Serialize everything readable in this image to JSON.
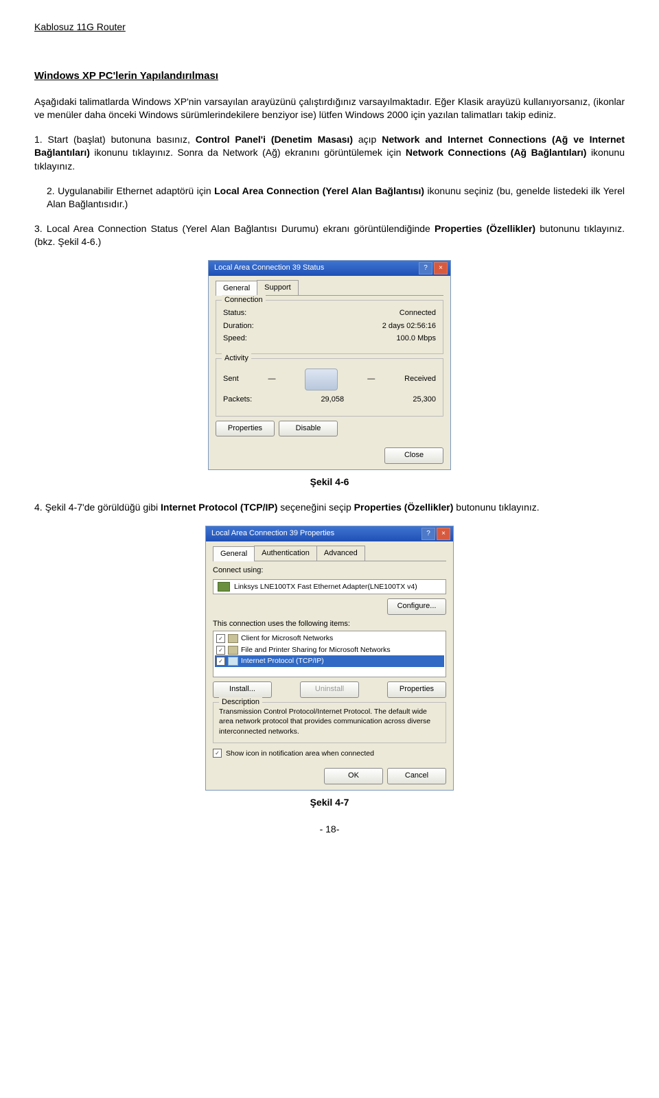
{
  "header": "Kablosuz 11G Router",
  "title": "Windows XP PC'lerin Yapılandırılması",
  "p_intro1": "Aşağıdaki talimatlarda Windows XP'nin varsayılan arayüzünü çalıştırdığınız varsayılmaktadır. Eğer Klasik arayüzü kullanıyorsanız, (ikonlar ve menüler daha önceki Windows sürümlerindekilere benziyor ise) lütfen Windows 2000 için yazılan talimatları takip ediniz.",
  "step1_a": "1. Start (başlat) butonuna basınız, ",
  "step1_b": "Control Panel'i (Denetim Masası)",
  "step1_c": " açıp ",
  "step1_d": "Network and Internet Connections (Ağ ve Internet Bağlantıları)",
  "step1_e": " ikonunu tıklayınız. Sonra da Network (Ağ) ekranını görüntülemek için ",
  "step1_f": "Network Connections (Ağ Bağlantıları)",
  "step1_g": " ikonunu tıklayınız.",
  "step2_a": "2. Uygulanabilir Ethernet adaptörü için ",
  "step2_b": "Local Area Connection (Yerel Alan Bağlantısı)",
  "step2_c": " ikonunu seçiniz (bu, genelde listedeki ilk Yerel Alan Bağlantısıdır.)",
  "step3_a": "3. Local Area Connection Status (Yerel Alan Bağlantısı Durumu) ekranı görüntülendiğinde ",
  "step3_b": "Properties (Özellikler)",
  "step3_c": " butonunu tıklayınız. (bkz. Şekil 4-6.)",
  "caption1": "Şekil 4-6",
  "step4_a": "4. Şekil 4-7'de görüldüğü gibi ",
  "step4_b": "Internet Protocol (TCP/IP)",
  "step4_c": " seçeneğini seçip ",
  "step4_d": "Properties (Özellikler)",
  "step4_e": " butonunu tıklayınız.",
  "caption2": "Şekil 4-7",
  "pagenum": "- 18-",
  "dlg1": {
    "title": "Local Area Connection 39 Status",
    "tab_general": "General",
    "tab_support": "Support",
    "grp_conn": "Connection",
    "status_k": "Status:",
    "status_v": "Connected",
    "dur_k": "Duration:",
    "dur_v": "2 days 02:56:16",
    "spd_k": "Speed:",
    "spd_v": "100.0 Mbps",
    "grp_act": "Activity",
    "sent": "Sent",
    "recv": "Received",
    "pkts_k": "Packets:",
    "pkts_s": "29,058",
    "pkts_r": "25,300",
    "btn_props": "Properties",
    "btn_disable": "Disable",
    "btn_close": "Close"
  },
  "dlg2": {
    "title": "Local Area Connection 39 Properties",
    "tab_general": "General",
    "tab_auth": "Authentication",
    "tab_adv": "Advanced",
    "connect_using": "Connect using:",
    "nic": "Linksys LNE100TX Fast Ethernet Adapter(LNE100TX v4)",
    "btn_configure": "Configure...",
    "items_label": "This connection uses the following items:",
    "item1": "Client for Microsoft Networks",
    "item2": "File and Printer Sharing for Microsoft Networks",
    "item3": "Internet Protocol (TCP/IP)",
    "btn_install": "Install...",
    "btn_uninstall": "Uninstall",
    "btn_props": "Properties",
    "desc_label": "Description",
    "desc_text": "Transmission Control Protocol/Internet Protocol. The default wide area network protocol that provides communication across diverse interconnected networks.",
    "show_icon": "Show icon in notification area when connected",
    "btn_ok": "OK",
    "btn_cancel": "Cancel"
  }
}
